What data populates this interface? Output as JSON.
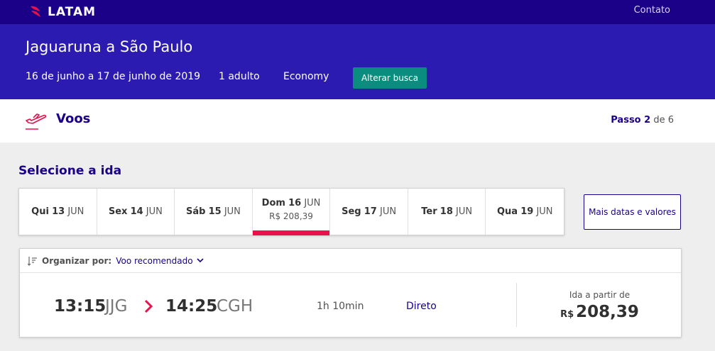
{
  "header": {
    "logo_text": "LATAM",
    "contact_label": "Contato"
  },
  "search": {
    "route": "Jaguaruna a São Paulo",
    "dates": "16 de junho a 17 de junho de 2019",
    "passengers": "1 adulto",
    "cabin": "Economy",
    "change_label": "Alterar busca"
  },
  "step": {
    "title": "Voos",
    "label": "Passo",
    "current": "2",
    "separator": "de",
    "total": "6"
  },
  "outbound": {
    "title": "Selecione a ida",
    "dates": [
      {
        "weekday": "Qui",
        "day": "13",
        "month": "JUN",
        "price": "",
        "active": false
      },
      {
        "weekday": "Sex",
        "day": "14",
        "month": "JUN",
        "price": "",
        "active": false
      },
      {
        "weekday": "Sáb",
        "day": "15",
        "month": "JUN",
        "price": "",
        "active": false
      },
      {
        "weekday": "Dom",
        "day": "16",
        "month": "JUN",
        "price": "R$ 208,39",
        "active": true
      },
      {
        "weekday": "Seg",
        "day": "17",
        "month": "JUN",
        "price": "",
        "active": false
      },
      {
        "weekday": "Ter",
        "day": "18",
        "month": "JUN",
        "price": "",
        "active": false
      },
      {
        "weekday": "Qua",
        "day": "19",
        "month": "JUN",
        "price": "",
        "active": false
      }
    ],
    "more_label": "Mais datas e valores"
  },
  "sort": {
    "label": "Organizar por:",
    "value": "Voo recomendado"
  },
  "flights": [
    {
      "departure_time": "13:15",
      "departure_code": "JJG",
      "arrival_time": "14:25",
      "arrival_code": "CGH",
      "duration": "1h 10min",
      "stops": "Direto",
      "price_label": "Ida a partir de",
      "currency": "R$",
      "price": "208,39"
    }
  ],
  "colors": {
    "brand_dark": "#1b0088",
    "banner": "#2c1bb0",
    "accent_red": "#e8114b",
    "cta_teal": "#0a8c7f"
  },
  "icons": [
    "latam-logo-icon",
    "plane-takeoff-icon",
    "sort-icon",
    "chevron-down-icon",
    "chevron-right-icon"
  ]
}
